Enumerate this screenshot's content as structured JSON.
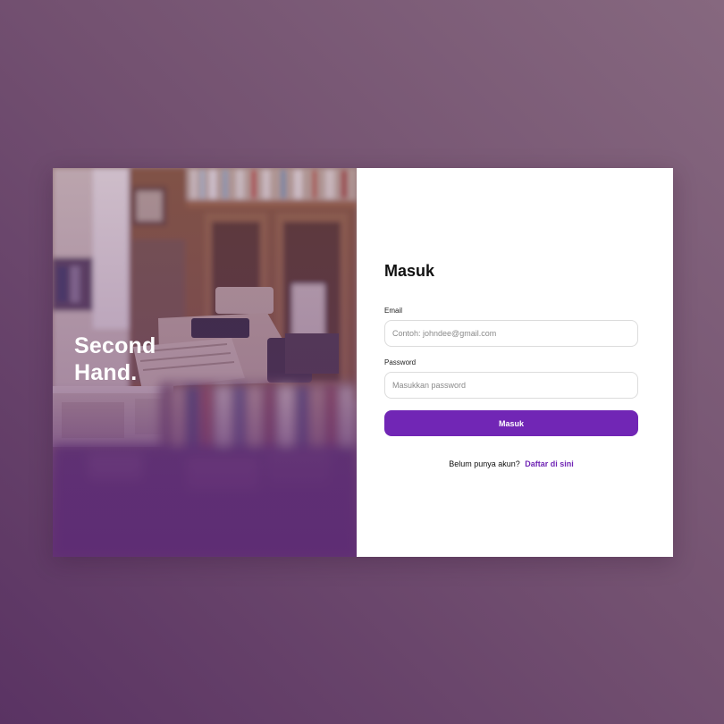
{
  "hero": {
    "title_line1": "Second",
    "title_line2": "Hand."
  },
  "login": {
    "heading": "Masuk",
    "email_label": "Email",
    "email_placeholder": "Contoh: johndee@gmail.com",
    "email_value": "",
    "password_label": "Password",
    "password_placeholder": "Masukkan password",
    "password_value": "",
    "submit_label": "Masuk",
    "register_prompt": "Belum punya akun?",
    "register_link": "Daftar di sini"
  },
  "colors": {
    "accent": "#7126b5",
    "background": "#745271",
    "hero_overlay": "#5e2b74"
  }
}
